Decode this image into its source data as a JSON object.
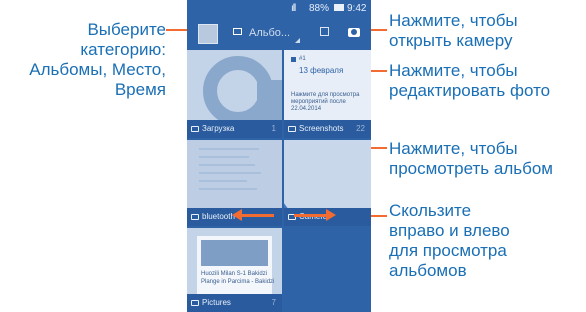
{
  "callouts": {
    "category": [
      "Выберите",
      "категорию:",
      "Альбомы, Место,",
      "Время"
    ],
    "camera": [
      "Нажмите, чтобы",
      "открыть камеру"
    ],
    "edit": [
      "Нажмите, чтобы",
      "редактировать фото"
    ],
    "album": [
      "Нажмите, чтобы",
      "просмотреть альбом"
    ],
    "swipe": [
      "Скользите",
      "вправо и влево",
      "для просмотра",
      "альбомов"
    ]
  },
  "phone": {
    "status": {
      "signal": "ıll",
      "battery": "88%",
      "time": "9:42"
    },
    "appbar": {
      "title": "Альбо..."
    },
    "tiles": [
      {
        "label": "Загрузка",
        "count": "1"
      },
      {
        "label": "Screenshots",
        "count": "22"
      },
      {
        "label": "bluetooth",
        "count": ""
      },
      {
        "label": "Camera",
        "count": ""
      },
      {
        "label": "Pictures",
        "count": "7"
      }
    ],
    "screenshot_card": {
      "number": "#1",
      "date": "13 февраля",
      "note1": "Нажмите для просмотра",
      "note2": "мероприятий после 22.04.2014"
    },
    "pictures_card": {
      "line1": "Huozili Milan S-1 Bakidzi",
      "line2": "Plange in Parcima - Bakidzi"
    }
  },
  "colors": {
    "accent": "#f26c32",
    "text_blue": "#1a6fb5",
    "phone_bg": "#2f63a8"
  },
  "icons": [
    "gallery-thumbnail-icon",
    "album-icon",
    "edit-icon",
    "camera-icon",
    "folder-icon"
  ]
}
